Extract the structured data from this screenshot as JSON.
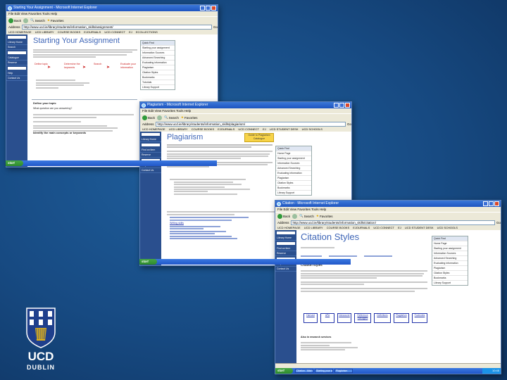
{
  "windows": [
    {
      "id": "assignment",
      "title": "Starting Your Assignment - Microsoft Internet Explorer",
      "menu": "File  Edit  View  Favorites  Tools  Help",
      "back_label": "Back",
      "search_label": "Search",
      "favorites_label": "Favorites",
      "address_label": "Address",
      "address": "http://www.ucd.ie/library/students/information_skills/assignment/",
      "go_label": "Go",
      "links": [
        "UCD HOMEPAGE",
        "UCD LIBRARY",
        "COURSE BOOKS",
        "EJOURNALS",
        "UCD CONNECT",
        "EJ",
        "ECOLLECTIONS"
      ],
      "heading": "Starting Your Assignment",
      "sidebar_items": [
        "Library Home",
        "Search",
        "Catalogue",
        "Reserve",
        "Help",
        "Contact Us"
      ],
      "flow_steps": [
        "Define topic",
        "Determine the keywords",
        "Search",
        "Evaluate your information"
      ],
      "menu_title": "Quick Find",
      "menu_items": [
        "Starting your assignment",
        "Information Sources",
        "Advanced Searching",
        "Evaluating information",
        "Plagiarism",
        "Citation Styles",
        "Bookmarks",
        "Tutorials",
        "Library Support"
      ],
      "section_head": "Define your topic",
      "question_line": "What question are you answering?",
      "sub_head": "Identify the main concepts or keywords"
    },
    {
      "id": "plagiarism",
      "title": "Plagiarism - Microsoft Internet Explorer",
      "menu": "File  Edit  View  Favorites  Tools  Help",
      "back_label": "Back",
      "search_label": "Search",
      "favorites_label": "Favorites",
      "address_label": "Address",
      "address": "http://www.ucd.ie/library/students/information_skills/plagiarism/",
      "go_label": "Go",
      "links": [
        "UCD HOMEPAGE",
        "UCD LIBRARY",
        "COURSE BOOKS",
        "EJOURNALS",
        "UCD CONNECT",
        "EJ",
        "UCD STUDENT DESK",
        "UCD SCHOOLS"
      ],
      "heading": "Plagiarism",
      "badge": "Guide to Plagiarism Catalogue",
      "sidebar_items": [
        "Library Home",
        "Find an item",
        "Reserve",
        "Help",
        "Contact Us"
      ],
      "menu_title": "Quick Find",
      "menu_items": [
        "Home Page",
        "Starting your assignment",
        "Information Sources",
        "Advanced Searching",
        "Evaluating information",
        "Plagiarism",
        "Citation Styles",
        "Bookmarks",
        "Library Support"
      ],
      "link_item": "Writing skills"
    },
    {
      "id": "citation",
      "title": "Citation - Microsoft Internet Explorer",
      "menu": "File  Edit  View  Favorites  Tools  Help",
      "back_label": "Back",
      "search_label": "Search",
      "favorites_label": "Favorites",
      "address_label": "Address",
      "address": "http://www.ucd.ie/library/students/information_skills/citation/",
      "go_label": "Go",
      "links": [
        "UCD HOMEPAGE",
        "UCD LIBRARY",
        "COURSE BOOKS",
        "EJOURNALS",
        "UCD CONNECT",
        "EJ",
        "UCD STUDENT DESK",
        "UCD SCHOOLS"
      ],
      "heading": "Citation Styles",
      "sidebar_items": [
        "Library Home",
        "Find an item",
        "Reserve",
        "Help",
        "Contact Us"
      ],
      "menu_title": "Quick Find",
      "menu_items": [
        "Home Page",
        "Starting your assignment",
        "Information Sources",
        "Advanced Searching",
        "Evaluating information",
        "Plagiarism",
        "Citation Styles",
        "Bookmarks",
        "Library Support"
      ],
      "section_head": "Citation styles",
      "tabs": [
        "Harvard",
        "APA",
        "Vancouver",
        "Reference managers",
        "Definitions",
        "Plagiarism",
        "Footnotes"
      ],
      "bottom_line": "Also in research services",
      "start_label": "start",
      "tasks": [
        "Citation - Microsoft",
        "Starting your assignment",
        "Plagiarism"
      ],
      "clock": "10:45"
    }
  ],
  "logo": {
    "line1": "UCD",
    "line2": "DUBLIN"
  },
  "colors": {
    "background": "#174a82",
    "sidebar": "#2a4f8e",
    "heading": "#3f66b7",
    "flow_red": "#cc2222",
    "logo_blue": "#1f3f8c"
  }
}
